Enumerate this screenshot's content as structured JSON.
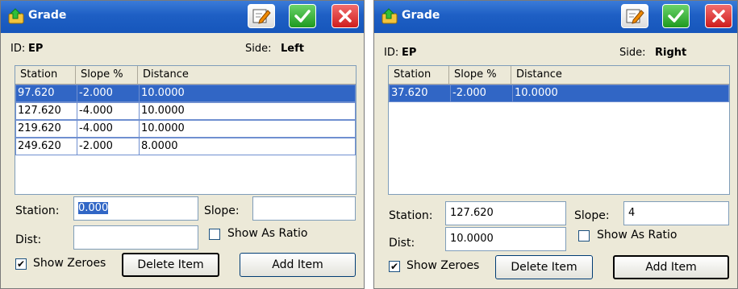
{
  "icons": {
    "title": "folder-up-arrow-icon",
    "edit": "edit-icon",
    "ok": "checkmark-icon",
    "cancel": "close-icon"
  },
  "colors": {
    "titlebar": "#1e5fc4",
    "selection": "#3166c5",
    "ok": "#1f9a1f",
    "cancel": "#cf1d1d"
  },
  "left": {
    "title": "Grade",
    "id_label": "ID:",
    "id_value": "EP",
    "side_label": "Side:",
    "side_value": "Left",
    "columns": [
      "Station",
      "Slope %",
      "Distance"
    ],
    "rows": [
      {
        "station": "97.620",
        "slope": "-2.000",
        "distance": "10.0000",
        "selected": true
      },
      {
        "station": "127.620",
        "slope": "-4.000",
        "distance": "10.0000",
        "selected": false
      },
      {
        "station": "219.620",
        "slope": "-4.000",
        "distance": "10.0000",
        "selected": false
      },
      {
        "station": "249.620",
        "slope": "-2.000",
        "distance": "8.0000",
        "selected": false
      }
    ],
    "station_label": "Station:",
    "station_value": "0.000",
    "slope_label": "Slope:",
    "slope_value": "",
    "dist_label": "Dist:",
    "dist_value": "",
    "show_as_ratio_label": "Show As Ratio",
    "show_as_ratio_checked": false,
    "show_zeroes_label": "Show Zeroes",
    "show_zeroes_checked": true,
    "delete_label": "Delete Item",
    "add_label": "Add Item"
  },
  "right": {
    "title": "Grade",
    "id_label": "ID:",
    "id_value": "EP",
    "side_label": "Side:",
    "side_value": "Right",
    "columns": [
      "Station",
      "Slope %",
      "Distance"
    ],
    "rows": [
      {
        "station": "37.620",
        "slope": "-2.000",
        "distance": "10.0000",
        "selected": true
      }
    ],
    "station_label": "Station:",
    "station_value": "127.620",
    "slope_label": "Slope:",
    "slope_value": "4",
    "dist_label": "Dist:",
    "dist_value": "10.0000",
    "show_as_ratio_label": "Show As Ratio",
    "show_as_ratio_checked": false,
    "show_zeroes_label": "Show Zeroes",
    "show_zeroes_checked": true,
    "delete_label": "Delete Item",
    "add_label": "Add Item"
  }
}
